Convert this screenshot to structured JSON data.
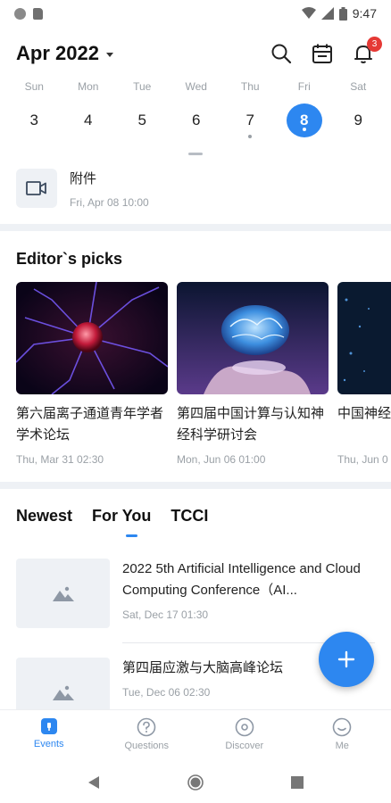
{
  "status_bar": {
    "time": "9:47"
  },
  "header": {
    "month": "Apr 2022",
    "notification_count": "3"
  },
  "week": {
    "days": [
      {
        "weekday": "Sun",
        "date": "3"
      },
      {
        "weekday": "Mon",
        "date": "4"
      },
      {
        "weekday": "Tue",
        "date": "5"
      },
      {
        "weekday": "Wed",
        "date": "6"
      },
      {
        "weekday": "Thu",
        "date": "7"
      },
      {
        "weekday": "Fri",
        "date": "8"
      },
      {
        "weekday": "Sat",
        "date": "9"
      }
    ],
    "selected": "8"
  },
  "event": {
    "title": "附件",
    "time": "Fri, Apr 08 10:00"
  },
  "editors_picks": {
    "title": "Editor`s picks",
    "items": [
      {
        "title": "第六届离子通道青年学者学术论坛",
        "time": "Thu, Mar 31 02:30"
      },
      {
        "title": "第四届中国计算与认知神经科学研讨会",
        "time": "Mon, Jun 06 01:00"
      },
      {
        "title": "中国神经病学",
        "time": "Thu, Jun 0"
      }
    ]
  },
  "feed_tabs": [
    {
      "label": "Newest"
    },
    {
      "label": "For You"
    },
    {
      "label": "TCCI"
    }
  ],
  "feed": [
    {
      "title": "2022 5th Artificial Intelligence and Cloud Computing Conference（AI...",
      "time": "Sat, Dec 17 01:30"
    },
    {
      "title": "第四届应激与大脑高峰论坛",
      "time": "Tue, Dec 06 02:30"
    }
  ],
  "bottom_nav": [
    {
      "label": "Events",
      "icon": "events-icon",
      "active": true
    },
    {
      "label": "Questions",
      "icon": "question-icon",
      "active": false
    },
    {
      "label": "Discover",
      "icon": "discover-icon",
      "active": false
    },
    {
      "label": "Me",
      "icon": "me-icon",
      "active": false
    }
  ],
  "colors": {
    "accent": "#2d87f0",
    "badge": "#e53935"
  }
}
